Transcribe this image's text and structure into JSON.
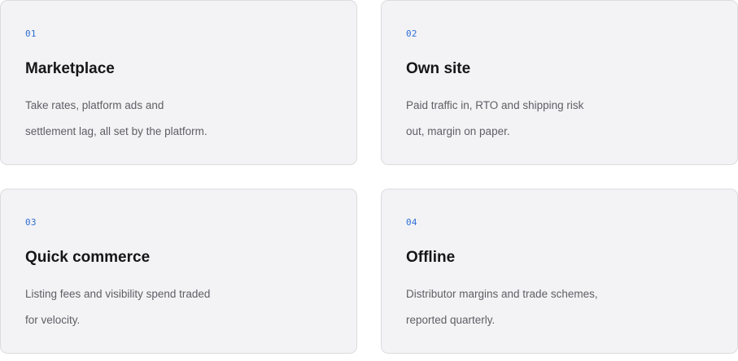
{
  "cards": [
    {
      "number": "01",
      "title": "Marketplace",
      "description": "Take rates, platform ads and settlement lag, all set by the platform."
    },
    {
      "number": "02",
      "title": "Own site",
      "description": "Paid traffic in, RTO and shipping risk out, margin on paper."
    },
    {
      "number": "03",
      "title": "Quick commerce",
      "description": "Listing fees and visibility spend traded for velocity."
    },
    {
      "number": "04",
      "title": "Offline",
      "description": "Distributor margins and trade schemes, reported quarterly."
    }
  ],
  "colors": {
    "accent": "#2f6fd6",
    "card_background": "#f3f3f5",
    "card_border": "#dcdce0",
    "title": "#16161a",
    "body_text": "#5e5e66"
  }
}
